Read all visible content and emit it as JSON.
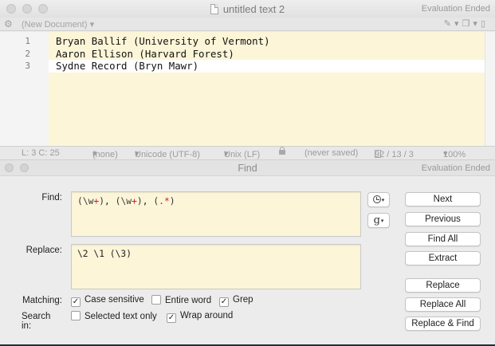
{
  "editor": {
    "title": "untitled text 2",
    "status_right": "Evaluation Ended",
    "navbar": {
      "document_menu": "(New Document)",
      "tool_icons": [
        "pen-icon",
        "stack-icon",
        "document-icon"
      ]
    },
    "lines": [
      {
        "num": "1",
        "text": "Bryan Ballif (University of Vermont)"
      },
      {
        "num": "2",
        "text": "Aaron Ellison (Harvard Forest)"
      },
      {
        "num": "3",
        "text": "Sydne Record (Bryn Mawr)"
      }
    ],
    "statusbar": {
      "position": "L: 3 C: 25",
      "language": "(none)",
      "encoding": "Unicode (UTF-8)",
      "line_endings": "Unix (LF)",
      "saved": "(never saved)",
      "stats": "92 / 13 / 3",
      "zoom": "100%"
    }
  },
  "find": {
    "title": "Find",
    "status_right": "Evaluation Ended",
    "find_label": "Find:",
    "find_value": "(\\w+), (\\w+), (.*)",
    "replace_label": "Replace:",
    "replace_value": "\\2 \\1 (\\3)",
    "buttons": {
      "next": "Next",
      "previous": "Previous",
      "find_all": "Find All",
      "extract": "Extract",
      "replace": "Replace",
      "replace_all": "Replace All",
      "replace_find": "Replace & Find"
    },
    "matching_label": "Matching:",
    "search_in_label": "Search in:",
    "options": {
      "case_sensitive": {
        "label": "Case sensitive",
        "checked": true
      },
      "entire_word": {
        "label": "Entire word",
        "checked": false
      },
      "grep": {
        "label": "Grep",
        "checked": true
      },
      "selected_text_only": {
        "label": "Selected text only",
        "checked": false
      },
      "wrap_around": {
        "label": "Wrap around",
        "checked": true
      }
    },
    "pattern_button_glyph": "g"
  },
  "colors": {
    "editor_background": "#fcf5d8",
    "grep_highlight": "#c91f1f"
  }
}
